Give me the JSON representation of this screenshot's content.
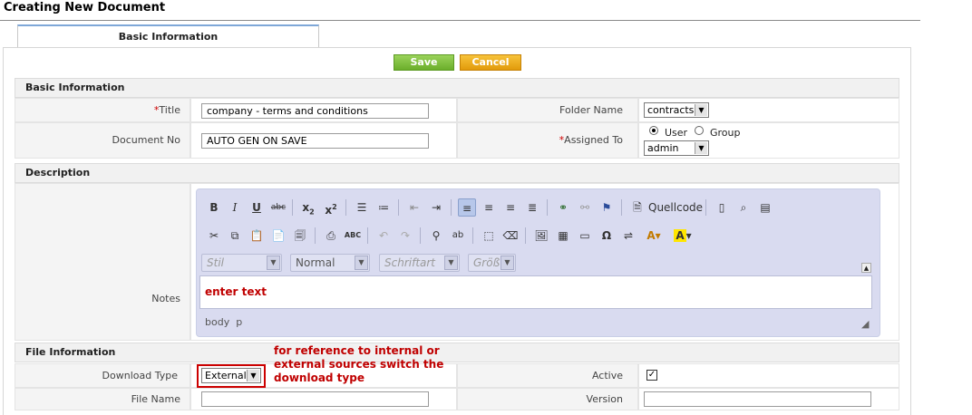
{
  "page": {
    "title": "Creating New Document"
  },
  "tabs": [
    {
      "label": "Basic Information"
    }
  ],
  "actions": {
    "save": "Save",
    "cancel": "Cancel"
  },
  "sections": {
    "basic": "Basic Information",
    "description": "Description",
    "file": "File Information"
  },
  "basic": {
    "title_req": "*",
    "title_label": "Title",
    "title_value": "company - terms and conditions",
    "docno_label": "Document No",
    "docno_value": "AUTO GEN ON SAVE",
    "folder_label": "Folder Name",
    "folder_value": "contracts",
    "assigned_req": "*",
    "assigned_label": "Assigned To",
    "assign_user": "User",
    "assign_group": "Group",
    "assign_selected": "User",
    "assigned_value": "admin"
  },
  "description": {
    "notes_label": "Notes",
    "editor": {
      "source_label": "Quellcode",
      "style_combo": "Stil",
      "format_combo": "Normal",
      "font_combo": "Schriftart",
      "size_combo": "Größ",
      "content": "enter text",
      "path": "body  p"
    }
  },
  "file": {
    "download_type_label": "Download Type",
    "download_type_value": "External",
    "active_label": "Active",
    "active_checked": true,
    "filename_label": "File Name",
    "filename_value": "",
    "version_label": "Version",
    "version_value": ""
  },
  "annotation": "for reference to internal or external sources switch the download type",
  "colors": {
    "save": "#7cc13c",
    "cancel": "#f0ad1c",
    "required": "#cc0000",
    "annotation": "#c00000",
    "editor_bg": "#d9dbf0"
  }
}
